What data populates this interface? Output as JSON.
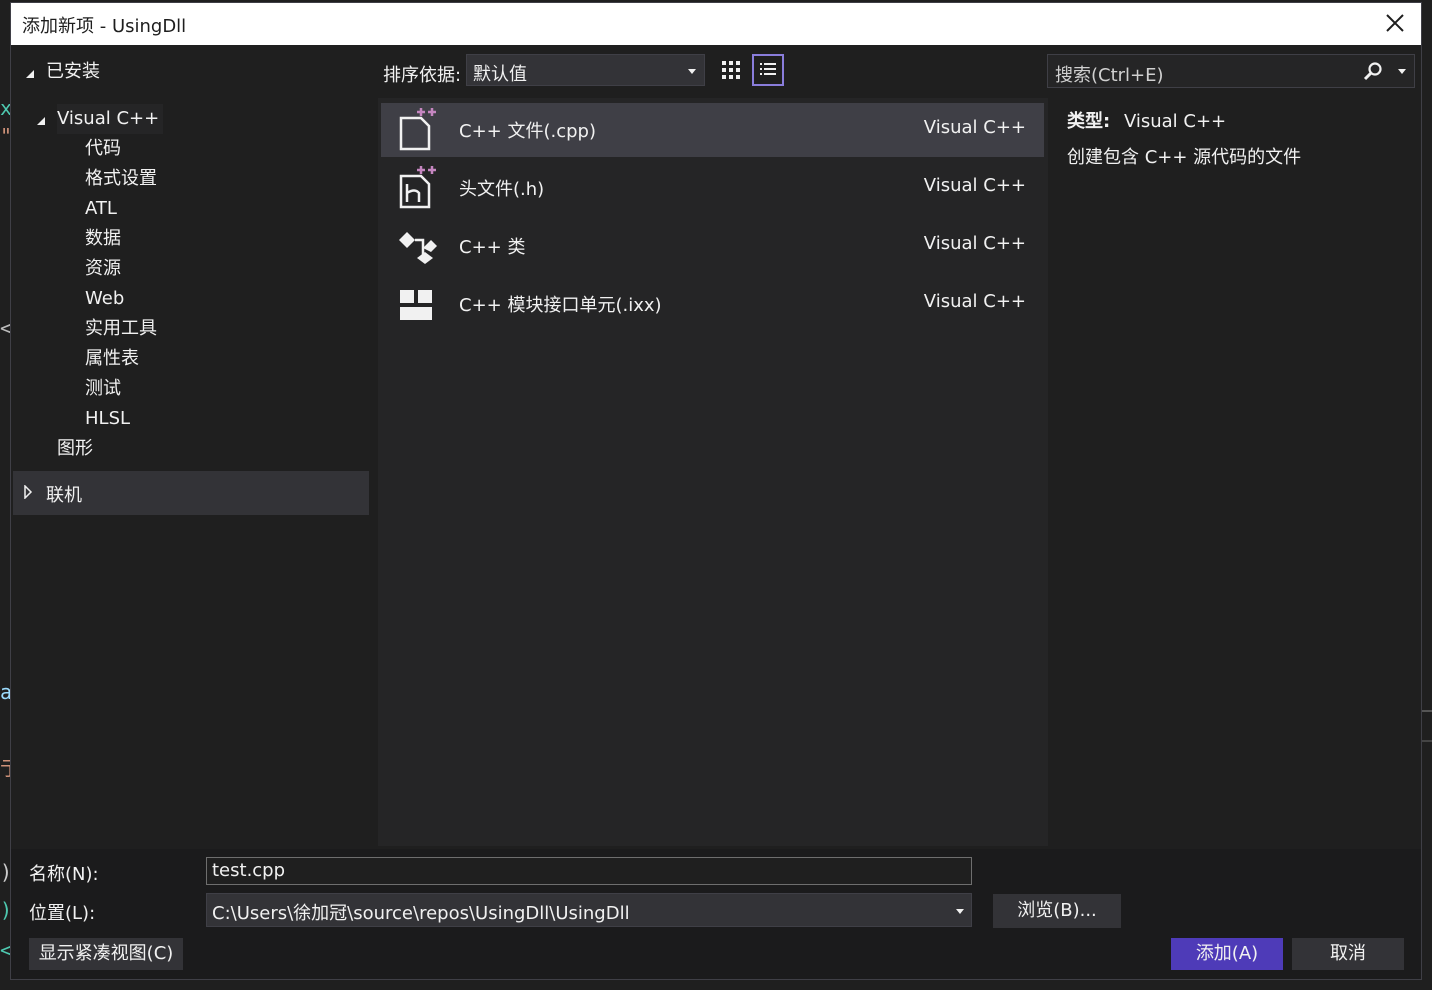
{
  "window": {
    "title": "添加新项 - UsingDll"
  },
  "tree": {
    "installed_label": "已安装",
    "visual_cpp_label": "Visual C++",
    "children": [
      "代码",
      "格式设置",
      "ATL",
      "数据",
      "资源",
      "Web",
      "实用工具",
      "属性表",
      "测试",
      "HLSL"
    ],
    "graphics_label": "图形",
    "online_label": "联机"
  },
  "toolbar": {
    "sort_label": "排序依据:",
    "sort_value": "默认值",
    "search_placeholder": "搜索(Ctrl+E)"
  },
  "items": [
    {
      "name": "C++ 文件(.cpp)",
      "lang": "Visual C++",
      "icon": "cpp-file-icon"
    },
    {
      "name": "头文件(.h)",
      "lang": "Visual C++",
      "icon": "header-file-icon"
    },
    {
      "name": "C++ 类",
      "lang": "Visual C++",
      "icon": "class-icon"
    },
    {
      "name": "C++ 模块接口单元(.ixx)",
      "lang": "Visual C++",
      "icon": "module-icon"
    }
  ],
  "details": {
    "type_label": "类型:",
    "type_value": "Visual C++",
    "description": "创建包含 C++ 源代码的文件"
  },
  "form": {
    "name_label": "名称(N):",
    "name_value": "test.cpp",
    "location_label": "位置(L):",
    "location_value": "C:\\Users\\徐加冠\\source\\repos\\UsingDll\\UsingDll",
    "browse_label": "浏览(B)...",
    "compact_label": "显示紧凑视图(C)",
    "add_label": "添加(A)",
    "cancel_label": "取消"
  },
  "colors": {
    "accent": "#4e3bb8",
    "active_border": "#8a7ddb",
    "icon_plus": "#c586c0"
  }
}
